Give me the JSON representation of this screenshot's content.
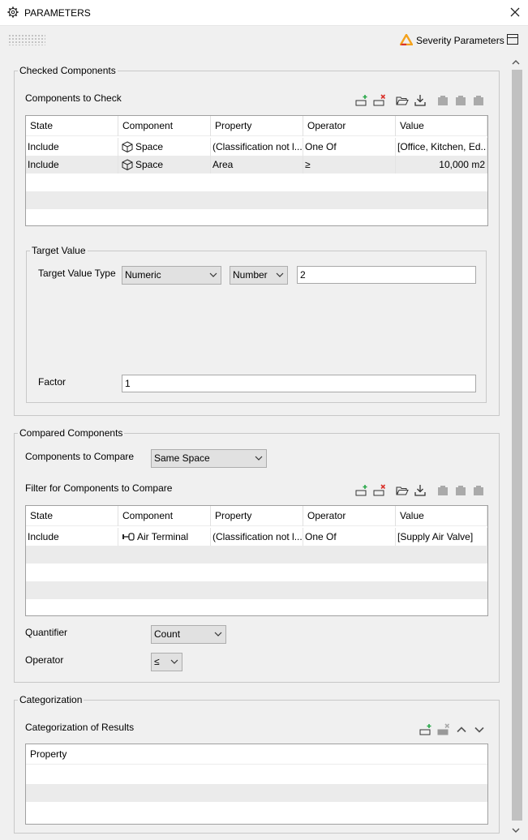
{
  "window": {
    "title": "PARAMETERS",
    "severity_label": "Severity Parameters"
  },
  "checked": {
    "legend": "Checked Components",
    "section_label": "Components to Check",
    "columns": [
      "State",
      "Component",
      "Property",
      "Operator",
      "Value"
    ],
    "rows": [
      {
        "state": "Include",
        "component": "Space",
        "property": "(Classification not l...",
        "operator": "One Of",
        "value": "[Office, Kitchen, Ed..."
      },
      {
        "state": "Include",
        "component": "Space",
        "property": "Area",
        "operator": "≥",
        "value": "10,000 m2"
      }
    ]
  },
  "target": {
    "legend": "Target Value",
    "type_label": "Target Value Type",
    "type_value": "Numeric",
    "unit_value": "Number",
    "number_value": "2",
    "factor_label": "Factor",
    "factor_value": "1"
  },
  "compared": {
    "legend": "Compared Components",
    "compare_label": "Components to Compare",
    "compare_value": "Same Space",
    "filter_label": "Filter for Components to Compare",
    "columns": [
      "State",
      "Component",
      "Property",
      "Operator",
      "Value"
    ],
    "rows": [
      {
        "state": "Include",
        "component": "Air Terminal",
        "property": "(Classification not l...",
        "operator": "One Of",
        "value": "[Supply Air Valve]"
      }
    ],
    "quantifier_label": "Quantifier",
    "quantifier_value": "Count",
    "operator_label": "Operator",
    "operator_value": "≤"
  },
  "categorization": {
    "legend": "Categorization",
    "section_label": "Categorization of Results",
    "columns": [
      "Property"
    ]
  },
  "colors": {
    "accent_red": "#d9322b",
    "accent_green": "#2aa84a",
    "severity_orange": "#f4a21c"
  }
}
